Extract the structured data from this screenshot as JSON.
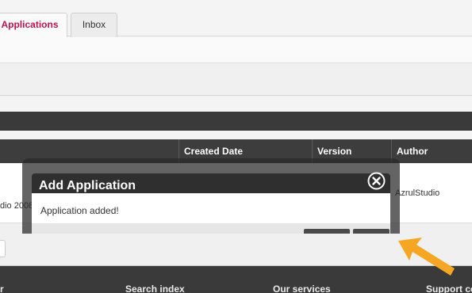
{
  "tabs": {
    "applications": "Applications",
    "inbox": "Inbox"
  },
  "table": {
    "headers": {
      "created_date": "Created Date",
      "version": "Version",
      "author": "Author"
    },
    "row": {
      "name_fragment": "dio 2008",
      "author": "AzrulStudio"
    }
  },
  "modal": {
    "title": "Add Application",
    "message": "Application added!",
    "close_icon": "close-icon"
  },
  "footer": {
    "links": [
      "dar",
      "Search index",
      "Our services",
      "Support ce"
    ]
  },
  "colors": {
    "accent_tab": "#c0124f",
    "dark_bar": "#3a3a3a",
    "arrow": "#f5a623"
  }
}
